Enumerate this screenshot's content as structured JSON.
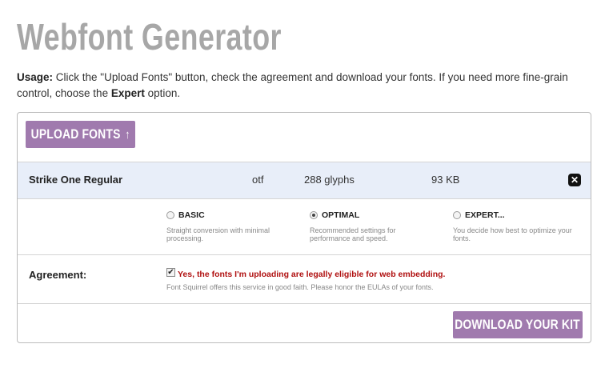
{
  "header": {
    "title": "Webfont Generator"
  },
  "usage": {
    "label": "Usage:",
    "text_before": " Click the \"Upload Fonts\" button, check the agreement and download your fonts. If you need more fine-grain control, choose the ",
    "expert": "Expert",
    "text_after": " option."
  },
  "upload_button": {
    "label": "UPLOAD FONTS",
    "icon": "arrow-up-icon"
  },
  "font_row": {
    "name": "Strike One Regular",
    "format": "otf",
    "glyphs": "288 glyphs",
    "size": "93 KB",
    "remove_icon": "close-icon"
  },
  "modes": {
    "selected": "optimal",
    "options": [
      {
        "id": "basic",
        "label": "BASIC",
        "desc": "Straight conversion with minimal processing."
      },
      {
        "id": "optimal",
        "label": "OPTIMAL",
        "desc": "Recommended settings for performance and speed."
      },
      {
        "id": "expert",
        "label": "EXPERT...",
        "desc": "You decide how best to optimize your fonts."
      }
    ]
  },
  "agreement": {
    "label": "Agreement:",
    "checked": true,
    "text": "Yes, the fonts I'm uploading are legally eligible for web embedding.",
    "note": "Font Squirrel offers this service in good faith. Please honor the EULAs of your fonts."
  },
  "download_button": {
    "label": "DOWNLOAD YOUR KIT"
  },
  "colors": {
    "accent": "#a07aae",
    "title": "#a7a7a7",
    "row_highlight": "#e8eef9",
    "warning": "#b01010"
  }
}
